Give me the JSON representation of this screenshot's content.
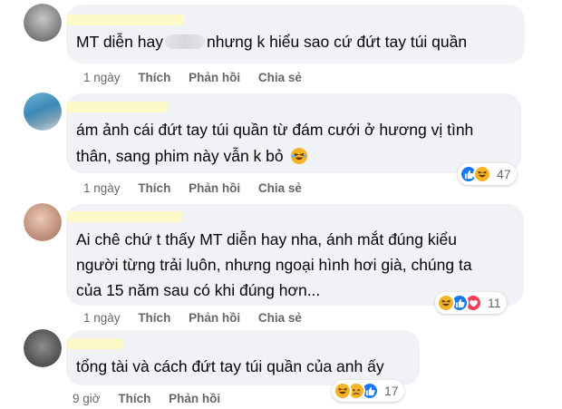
{
  "comments": [
    {
      "text_lines": [
        "MT diễn hay",
        "nhưng k hiểu sao cứ đứt tay túi quần"
      ],
      "time": "1 ngày",
      "like": "Thích",
      "reply": "Phản hồi",
      "share": "Chia sẻ",
      "reaction_count": ""
    },
    {
      "text_lines": [
        "ám ảnh cái đứt tay túi quần từ đám cưới ở hương vị tình",
        "thân, sang phim này vẫn k bỏ"
      ],
      "time": "1 ngày",
      "like": "Thích",
      "reply": "Phản hồi",
      "share": "Chia sẻ",
      "reaction_count": "47",
      "reactions": [
        "like-icon",
        "haha-icon"
      ]
    },
    {
      "text_lines": [
        "Ai chê chứ t thấy MT diễn hay nha, ánh mắt đúng kiểu",
        "người từng trải luôn, nhưng ngoại hình hơi già, chúng ta",
        "của 15 năm sau có khi đúng hơn..."
      ],
      "time": "1 ngày",
      "like": "Thích",
      "reply": "Phản hồi",
      "share": "Chia sẻ",
      "reaction_count": "11",
      "reactions": [
        "haha-icon",
        "like-icon",
        "love-icon"
      ]
    },
    {
      "text_lines": [
        "tổng tài và cách đứt tay túi quần của anh ấy"
      ],
      "time": "9 giờ",
      "like": "Thích",
      "reply": "Phản hồi",
      "reaction_count": "17",
      "reactions": [
        "haha-icon",
        "sad-icon",
        "like-icon"
      ]
    }
  ],
  "colors": {
    "bubble": "#f0f2f5",
    "meta_text": "#65676b",
    "like_blue": "#1877f2",
    "haha_yellow": "#f7b125",
    "love_red": "#f33e58",
    "name_redaction": "#fdf8c8"
  }
}
